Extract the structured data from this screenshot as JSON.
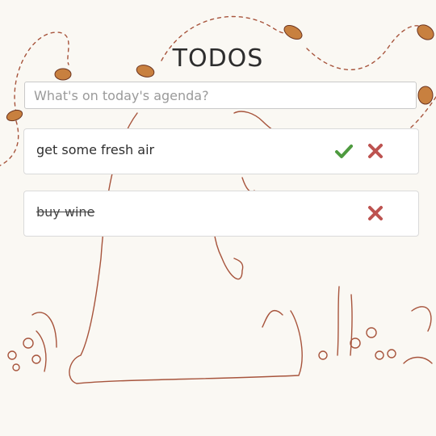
{
  "header": {
    "title": "TODOS"
  },
  "input": {
    "placeholder": "What's on today's agenda?",
    "value": ""
  },
  "todos": [
    {
      "text": "get some fresh air",
      "done": false
    },
    {
      "text": "buy wine",
      "done": true
    }
  ],
  "colors": {
    "illustration": "#a7543c",
    "check": "#4e9a3f",
    "delete": "#bd5350",
    "background": "#faf8f3"
  },
  "icons": {
    "complete": "check-icon",
    "delete": "cross-icon"
  }
}
